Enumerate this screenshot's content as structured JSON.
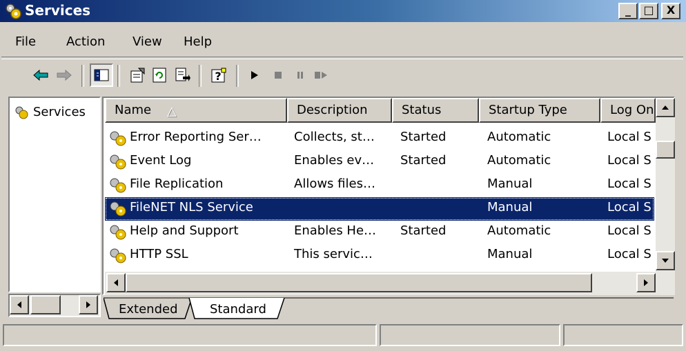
{
  "window": {
    "title": "Services"
  },
  "titlebar": {
    "min": "_",
    "max": "□",
    "close": "X"
  },
  "menu": [
    {
      "label": "File"
    },
    {
      "label": "Action"
    },
    {
      "label": "View"
    },
    {
      "label": "Help"
    }
  ],
  "toolbar": [
    "back-icon",
    "forward-icon",
    "show-hide-tree-icon",
    "properties-icon",
    "refresh-icon",
    "export-list-icon",
    "help-icon",
    "start-service-icon",
    "stop-service-icon",
    "pause-service-icon",
    "restart-service-icon"
  ],
  "tree": {
    "label": "Services"
  },
  "columns": [
    "Name",
    "Description",
    "Status",
    "Startup Type",
    "Log On"
  ],
  "rows": [
    {
      "name": "Error Reporting Ser…",
      "description": "Collects, st…",
      "status": "Started",
      "startup": "Automatic",
      "logon": "Local S"
    },
    {
      "name": "Event Log",
      "description": "Enables ev…",
      "status": "Started",
      "startup": "Automatic",
      "logon": "Local S"
    },
    {
      "name": "File Replication",
      "description": "Allows files…",
      "status": "",
      "startup": "Manual",
      "logon": "Local S"
    },
    {
      "name": "FileNET NLS Service",
      "description": "",
      "status": "",
      "startup": "Manual",
      "logon": "Local S",
      "selected": true
    },
    {
      "name": "Help and Support",
      "description": "Enables He…",
      "status": "Started",
      "startup": "Automatic",
      "logon": "Local S"
    },
    {
      "name": "HTTP SSL",
      "description": "This servic…",
      "status": "",
      "startup": "Manual",
      "logon": "Local S"
    }
  ],
  "tabs": [
    {
      "label": "Extended"
    },
    {
      "label": "Standard"
    }
  ],
  "colors": {
    "titlebar": "#0a246a",
    "selection": "#0a246a",
    "face": "#d4d0c8"
  }
}
